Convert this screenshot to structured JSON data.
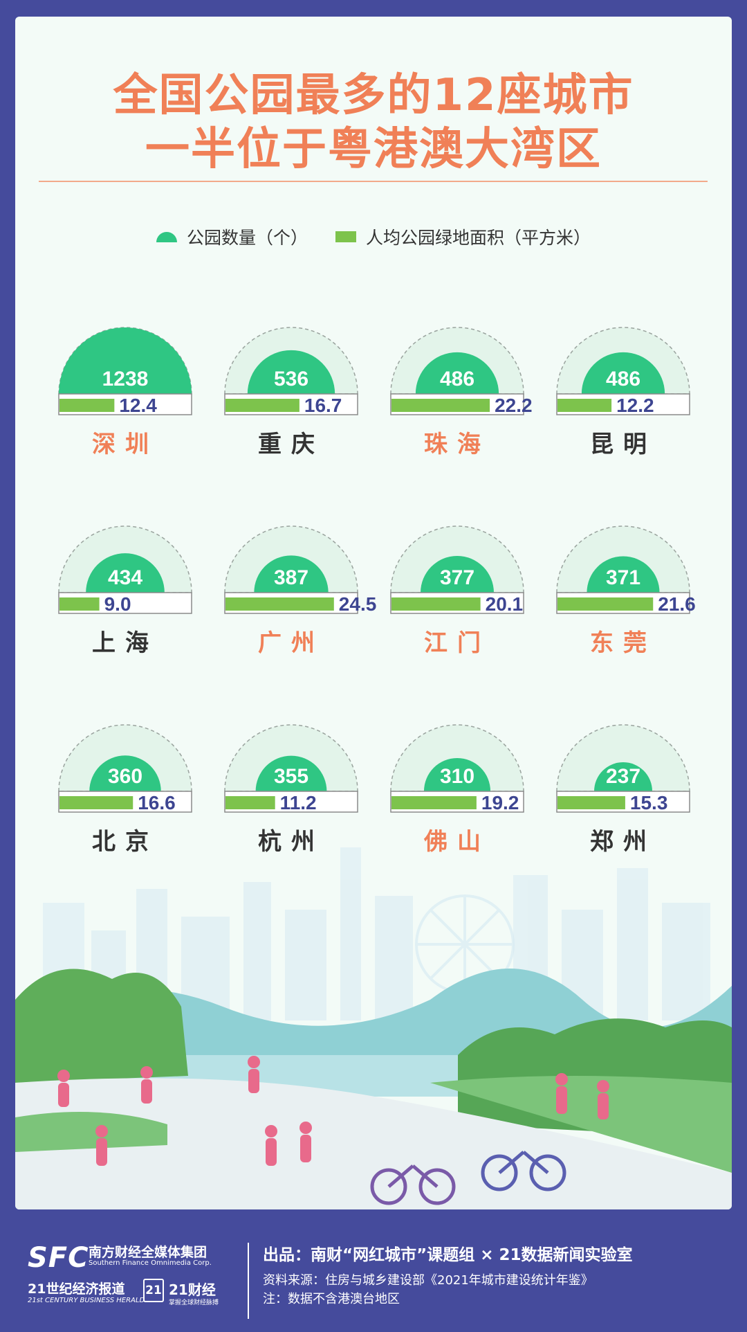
{
  "title": {
    "line1": "全国公园最多的12座城市",
    "line2": "一半位于粤港澳大湾区"
  },
  "legend": {
    "parks": "公园数量（个）",
    "area": "人均公园绿地面积（平方米）"
  },
  "colors": {
    "parks": "#2fc683",
    "area": "#7dc34c",
    "value_text": "#3d4591",
    "highlight_city": "#f08057",
    "normal_city": "#333333",
    "background": "#454b9c"
  },
  "chart_data": {
    "type": "bar",
    "max_parks": 1238,
    "categories": [
      "深圳",
      "重庆",
      "珠海",
      "昆明",
      "上海",
      "广州",
      "江门",
      "东莞",
      "北京",
      "杭州",
      "佛山",
      "郑州"
    ],
    "bay_area": [
      true,
      false,
      true,
      false,
      false,
      true,
      true,
      true,
      false,
      false,
      true,
      false
    ],
    "series": [
      {
        "name": "公园数量（个）",
        "values": [
          1238,
          536,
          486,
          486,
          434,
          387,
          377,
          371,
          360,
          355,
          310,
          237
        ]
      },
      {
        "name": "人均公园绿地面积（平方米）",
        "values": [
          "12.4",
          "16.7",
          "22.2",
          "12.2",
          "9.0",
          "24.5",
          "20.1",
          "21.6",
          "16.6",
          "11.2",
          "19.2",
          "15.3"
        ]
      }
    ],
    "area_max": 30
  },
  "footer": {
    "sfc_logo": "SFC",
    "sfc_name": "南方财经全媒体集团",
    "sfc_en": "Southern Finance Omnimedia Corp.",
    "cbh": "21世纪经济报道",
    "cbh_en": "21st CENTURY BUSINESS HERALD",
    "c21_box": "21",
    "c21": "21财经",
    "c21_sub": "掌握全球财经脉搏",
    "produced_by": "出品：南财“网红城市”课题组 × 21数据新闻实验室",
    "source": "资料来源：住房与城乡建设部《2021年城市建设统计年鉴》",
    "note": "注：数据不含港澳台地区"
  }
}
